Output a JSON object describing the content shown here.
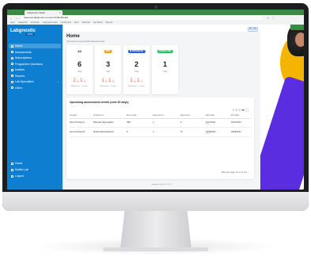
{
  "browser": {
    "tab_title": "Labgnostic SaaS",
    "url": "saas.test.labgnostic.com/en/v2/dashboard",
    "bookmarks": [
      "Apps",
      "Labgnostic",
      "Ad Studio",
      "Labgnostic SaaS",
      "Lab Results",
      "Docs",
      "Calendar",
      "Test Stand",
      "Reports"
    ]
  },
  "sidebar": {
    "logo": "Labgnostic",
    "logo_badge": "SAAS",
    "items": [
      {
        "label": "Home",
        "active": true
      },
      {
        "label": "Assessments"
      },
      {
        "label": "Subscriptions"
      },
      {
        "label": "Programme Questions"
      },
      {
        "label": "Invitees"
      },
      {
        "label": "Reports"
      },
      {
        "label": "Lab Specialties",
        "has_children": true
      },
      {
        "label": "Users"
      }
    ],
    "bottom_items": [
      {
        "label": "Home"
      },
      {
        "label": "Switch Lab"
      },
      {
        "label": "Logout"
      }
    ]
  },
  "topbar": {
    "lang_button": "Myr Lab"
  },
  "page": {
    "title": "Home",
    "subtitle": "Overview of your EQA assessments"
  },
  "status_cards": [
    {
      "pill": "All",
      "count": "6",
      "count_label": "Total",
      "alert_a": "2",
      "alert_b": "1",
      "label_a": "Ending soon",
      "label_b": "Overdue"
    },
    {
      "pill": "NEW",
      "pill_color": "#f59e0b",
      "count": "3",
      "count_label": "Total",
      "alert_a": "1",
      "alert_b": "1",
      "label_a": "Ending soon",
      "label_b": "Overdue"
    },
    {
      "pill": "IN PROGRESS",
      "pill_color": "#2563eb",
      "count": "2",
      "count_label": "Total",
      "alert_a": "1",
      "alert_b": "1",
      "label_a": "Ending soon",
      "label_b": "Overdue"
    },
    {
      "pill": "COMPLETED",
      "pill_color": "#22c55e",
      "count": "1",
      "count_label": "Total"
    }
  ],
  "upcoming": {
    "title": "Upcoming assessment events (next 30 days)",
    "columns": [
      "Provider",
      "Programme",
      "Event code",
      "Assessment",
      "Specimens",
      "Start date",
      "End date"
    ],
    "rows": [
      {
        "provider": "Demo Provider A",
        "programme": "Rounded Haemoglobin",
        "event_code": "HB3",
        "assessment": "1",
        "specimens": "5",
        "start": "11/07/2024",
        "start_sub": "11:00",
        "end": "18/07/2024"
      },
      {
        "provider": "Demo Provider B",
        "programme": "Protein Electrophoresis",
        "event_code": "8",
        "assessment": "2",
        "specimens": "10",
        "start": "18/08/2024",
        "start_sub": "01:00",
        "end": "28/08/2024"
      }
    ],
    "pager": "Rows per page: 10  ▾   1-2 of 2   ‹  ›"
  },
  "footer": "Labgnostic SaaS v1.0 ©2024"
}
